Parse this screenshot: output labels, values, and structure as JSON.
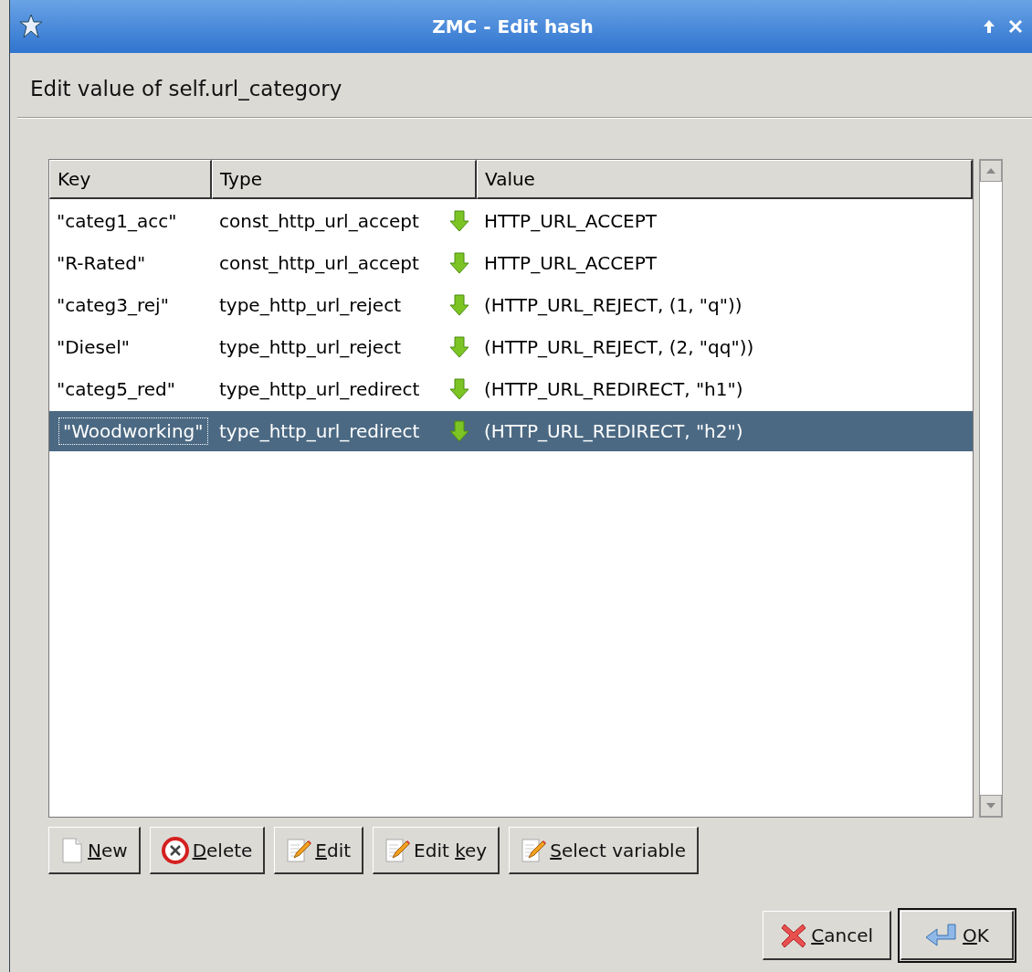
{
  "window": {
    "title": "ZMC - Edit hash"
  },
  "heading": "Edit value of self.url_category",
  "table": {
    "columns": [
      "Key",
      "Type",
      "Value"
    ],
    "rows": [
      {
        "key": "\"categ1_acc\"",
        "type": "const_http_url_accept",
        "value": "HTTP_URL_ACCEPT",
        "selected": false
      },
      {
        "key": "\"R-Rated\"",
        "type": "const_http_url_accept",
        "value": "HTTP_URL_ACCEPT",
        "selected": false
      },
      {
        "key": "\"categ3_rej\"",
        "type": "type_http_url_reject",
        "value": "(HTTP_URL_REJECT, (1, \"q\"))",
        "selected": false
      },
      {
        "key": "\"Diesel\"",
        "type": "type_http_url_reject",
        "value": "(HTTP_URL_REJECT, (2, \"qq\"))",
        "selected": false
      },
      {
        "key": "\"categ5_red\"",
        "type": "type_http_url_redirect",
        "value": "(HTTP_URL_REDIRECT, \"h1\")",
        "selected": false
      },
      {
        "key": "\"Woodworking\"",
        "type": "type_http_url_redirect",
        "value": "(HTTP_URL_REDIRECT, \"h2\")",
        "selected": true
      }
    ]
  },
  "actions": [
    {
      "kind": "new",
      "key": "N",
      "post": "ew"
    },
    {
      "kind": "delete",
      "key": "D",
      "post": "elete"
    },
    {
      "kind": "edit",
      "key": "E",
      "post": "dit"
    },
    {
      "kind": "edit",
      "pre": "Edit ",
      "key": "k",
      "post": "ey"
    },
    {
      "kind": "edit",
      "key": "S",
      "post": "elect variable"
    }
  ],
  "dialog_buttons": [
    {
      "kind": "cancel",
      "key": "C",
      "post": "ancel",
      "default": false
    },
    {
      "kind": "ok",
      "key": "O",
      "post": "K",
      "default": true
    }
  ]
}
